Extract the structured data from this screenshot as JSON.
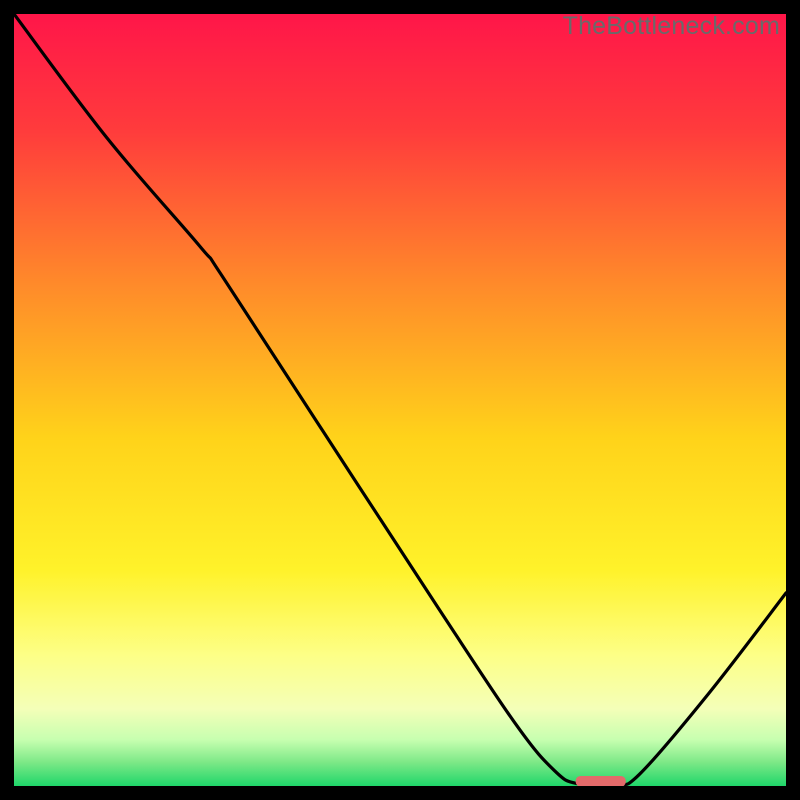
{
  "watermark": "TheBottleneck.com",
  "chart_data": {
    "type": "line",
    "title": "",
    "xlabel": "",
    "ylabel": "",
    "xlim": [
      0,
      100
    ],
    "ylim": [
      0,
      100
    ],
    "gradient_stops": [
      {
        "pct": 0,
        "color": "#ff1649"
      },
      {
        "pct": 15,
        "color": "#ff3b3c"
      },
      {
        "pct": 35,
        "color": "#ff8a2a"
      },
      {
        "pct": 55,
        "color": "#ffd31a"
      },
      {
        "pct": 72,
        "color": "#fff22a"
      },
      {
        "pct": 83,
        "color": "#fdff86"
      },
      {
        "pct": 90,
        "color": "#f4ffb8"
      },
      {
        "pct": 94,
        "color": "#c7ffb0"
      },
      {
        "pct": 97,
        "color": "#7be886"
      },
      {
        "pct": 100,
        "color": "#1fd66a"
      }
    ],
    "curve_points": [
      {
        "x": 0.0,
        "y": 100.0
      },
      {
        "x": 12.0,
        "y": 84.0
      },
      {
        "x": 24.0,
        "y": 70.0
      },
      {
        "x": 27.0,
        "y": 66.0
      },
      {
        "x": 40.0,
        "y": 46.0
      },
      {
        "x": 55.0,
        "y": 23.0
      },
      {
        "x": 65.0,
        "y": 8.0
      },
      {
        "x": 70.0,
        "y": 2.0
      },
      {
        "x": 73.0,
        "y": 0.3
      },
      {
        "x": 78.0,
        "y": 0.3
      },
      {
        "x": 81.0,
        "y": 1.5
      },
      {
        "x": 90.0,
        "y": 12.0
      },
      {
        "x": 100.0,
        "y": 25.0
      }
    ],
    "marker": {
      "x": 76.0,
      "y": 0.6,
      "w": 6.5,
      "h": 1.4,
      "color": "#e26a6a"
    }
  }
}
